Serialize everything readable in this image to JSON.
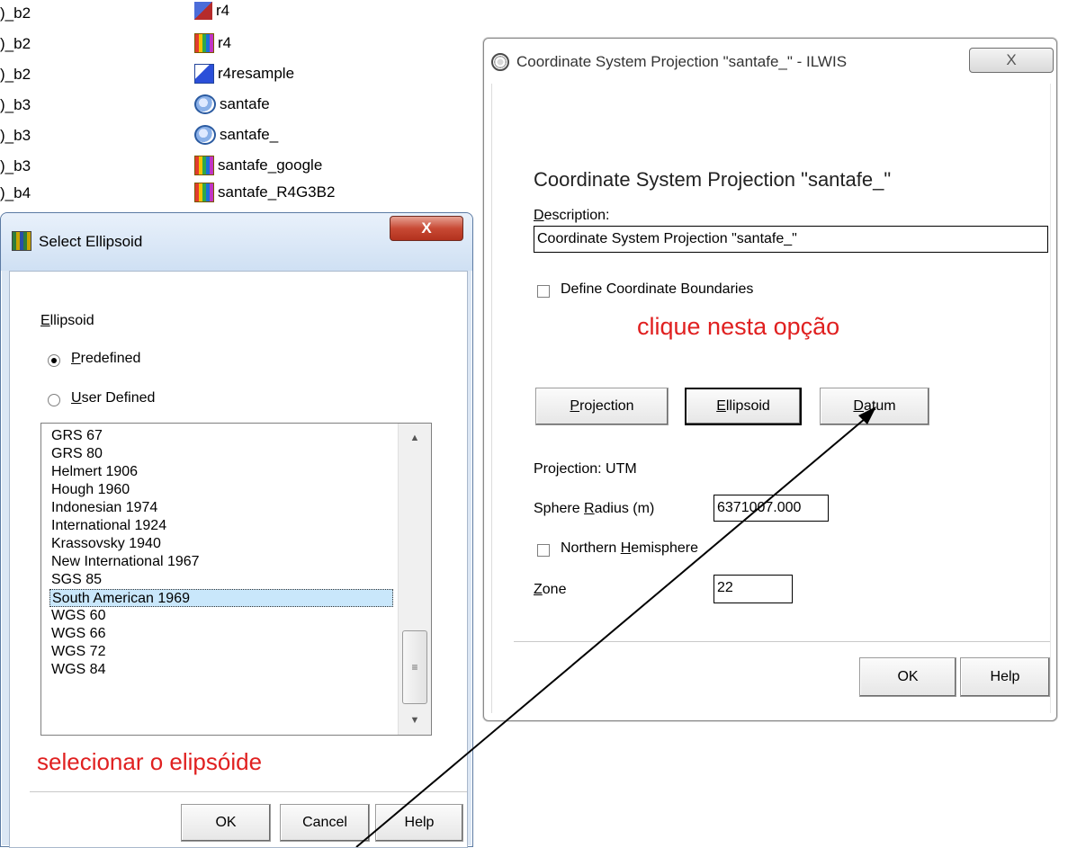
{
  "background_list": {
    "left_fragments": [
      ")_b2",
      ")_b2",
      ")_b2",
      ")_b3",
      ")_b3",
      ")_b3",
      ")_b4"
    ],
    "items": [
      {
        "name": "r4",
        "icon": "raster-map-icon"
      },
      {
        "name": "r4resample",
        "icon": "resampled-map-icon"
      },
      {
        "name": "santafe",
        "icon": "coordinate-system-icon"
      },
      {
        "name": "santafe_",
        "icon": "coordinate-system-icon"
      },
      {
        "name": "santafe_google",
        "icon": "raster-map-icon"
      },
      {
        "name": "santafe_R4G3B2",
        "icon": "raster-map-icon"
      }
    ],
    "top_partial": "r4"
  },
  "csp_window": {
    "title": "Coordinate System Projection \"santafe_\" - ILWIS",
    "close_label": "X",
    "heading": "Coordinate System Projection \"santafe_\"",
    "description_label_u": "D",
    "description_label_rest": "escription:",
    "description_value": "Coordinate System Projection \"santafe_\"",
    "define_boundaries_label": "Define Coordinate Boundaries",
    "define_boundaries_checked": false,
    "buttons": {
      "projection_u": "P",
      "projection_rest": "rojection",
      "ellipsoid_u": "E",
      "ellipsoid_rest": "llipsoid",
      "datum_u": "D",
      "datum_rest": "atum",
      "ok": "OK",
      "help": "Help"
    },
    "projection_text": "Projection: UTM",
    "radius_label_pre": "Sphere ",
    "radius_label_u": "R",
    "radius_label_rest": "adius (m)",
    "radius_value": "6371007.000",
    "northern_label_pre": "Northern ",
    "northern_label_u": "H",
    "northern_label_rest": "emisphere",
    "northern_checked": false,
    "zone_label_u": "Z",
    "zone_label_rest": "one",
    "zone_value": "22"
  },
  "sel_window": {
    "title": "Select Ellipsoid",
    "close_label": "X",
    "group_label_u": "E",
    "group_label_rest": "llipsoid",
    "predefined_u": "P",
    "predefined_rest": "redefined",
    "predefined_checked": true,
    "user_defined_u": "U",
    "user_defined_rest": "ser Defined",
    "ellipsoids": [
      "GRS 67",
      "GRS 80",
      "Helmert 1906",
      "Hough 1960",
      "Indonesian 1974",
      "International 1924",
      "Krassovsky 1940",
      "New International 1967",
      "SGS 85",
      "South American 1969",
      "WGS 60",
      "WGS 66",
      "WGS 72",
      "WGS 84"
    ],
    "selected_ellipsoid": "South American 1969",
    "buttons": {
      "ok": "OK",
      "cancel": "Cancel",
      "help": "Help"
    }
  },
  "annotations": {
    "click_option": "clique nesta opção",
    "select_ellipsoid": "selecionar o elipsóide"
  },
  "colors": {
    "annotation": "#e02020",
    "selection": "#c9e7fb",
    "sel_frame": "#dce7f4",
    "close_red": "#c84a35"
  }
}
